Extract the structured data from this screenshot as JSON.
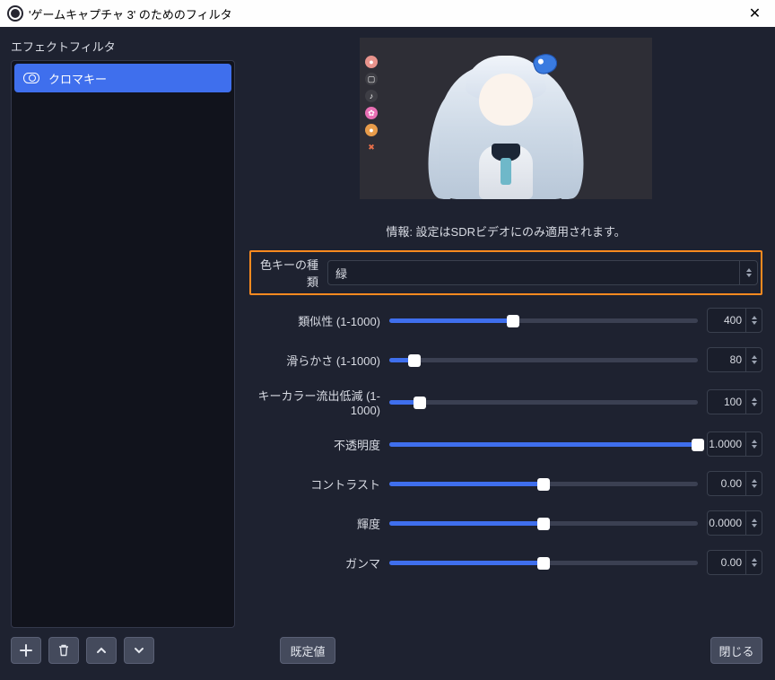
{
  "window": {
    "title": "'ゲームキャプチャ 3' のためのフィルタ"
  },
  "sidebar": {
    "heading": "エフェクトフィルタ",
    "items": [
      {
        "label": "クロマキー"
      }
    ]
  },
  "info_text": "情報: 設定はSDRビデオにのみ適用されます。",
  "key_color": {
    "label": "色キーの種類",
    "value": "緑"
  },
  "sliders": [
    {
      "label": "類似性 (1-1000)",
      "value": "400",
      "pct": 40
    },
    {
      "label": "滑らかさ (1-1000)",
      "value": "80",
      "pct": 8
    },
    {
      "label": "キーカラー流出低減 (1-1000)",
      "value": "100",
      "pct": 10
    },
    {
      "label": "不透明度",
      "value": "1.0000",
      "pct": 100
    },
    {
      "label": "コントラスト",
      "value": "0.00",
      "pct": 50
    },
    {
      "label": "輝度",
      "value": "0.0000",
      "pct": 50
    },
    {
      "label": "ガンマ",
      "value": "0.00",
      "pct": 50
    }
  ],
  "buttons": {
    "defaults": "既定値",
    "close": "閉じる"
  }
}
